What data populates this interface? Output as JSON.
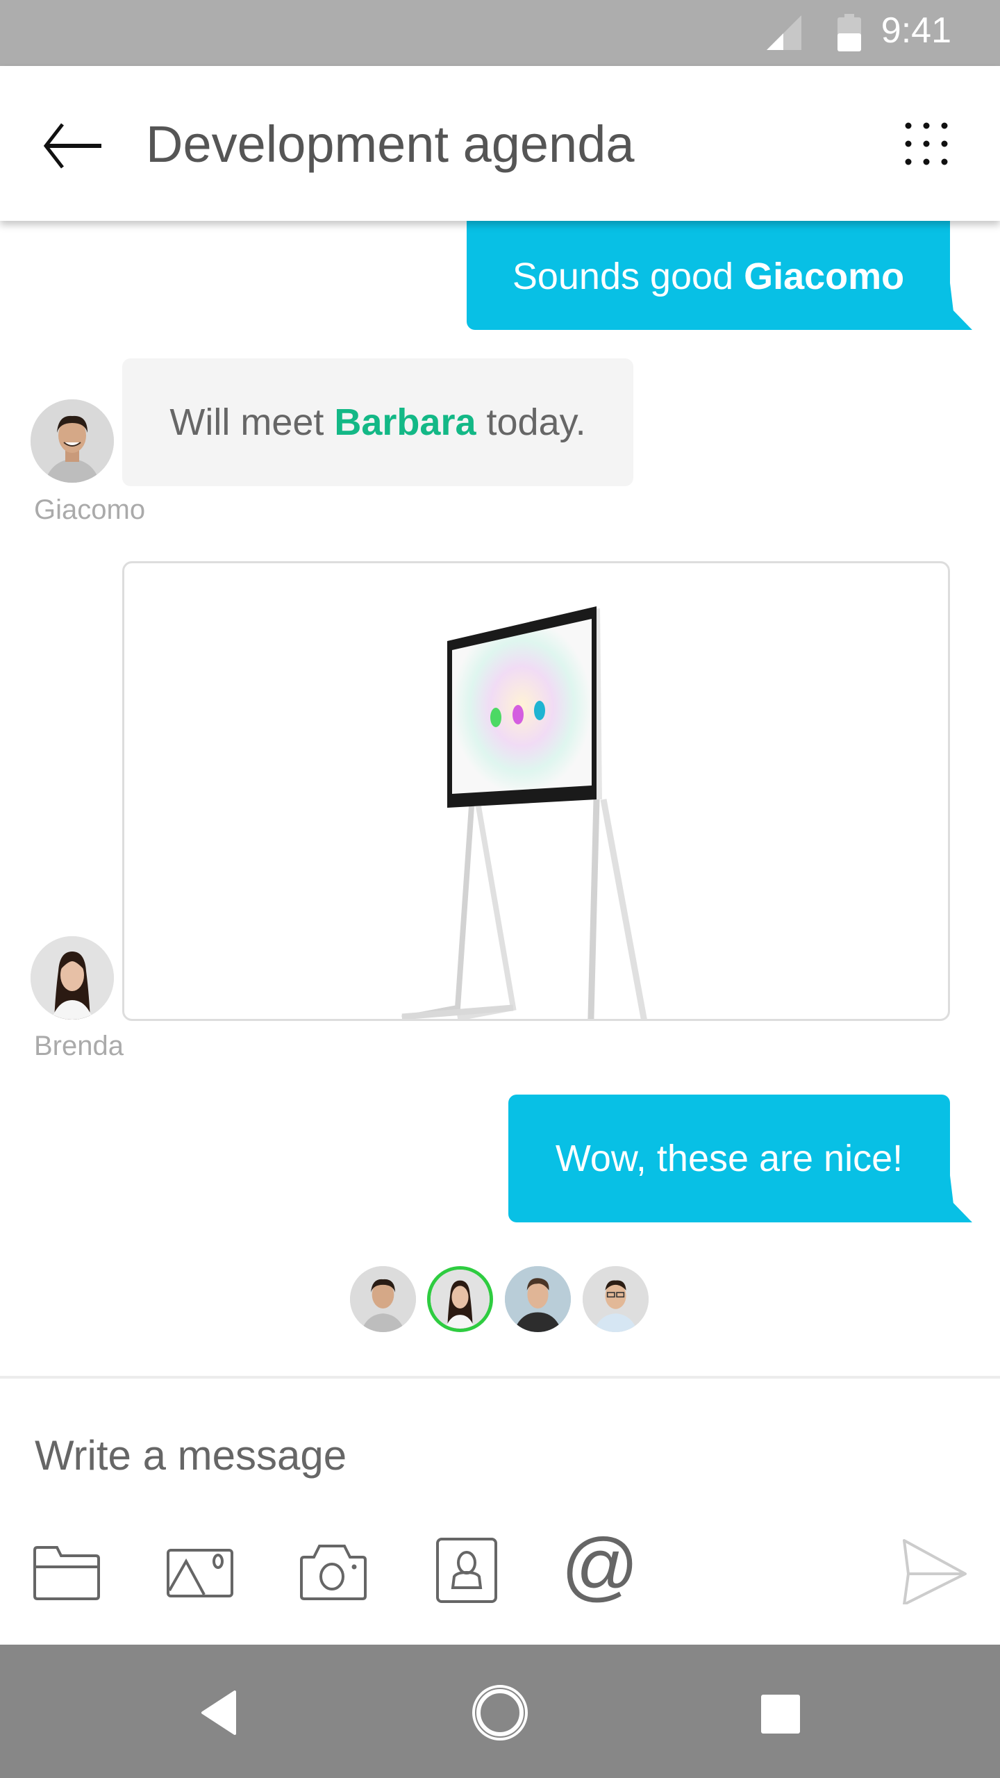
{
  "status_bar": {
    "time": "9:41",
    "signal_icon": "signal-icon",
    "battery_icon": "battery-icon"
  },
  "header": {
    "title": "Development agenda",
    "back_icon": "back-arrow-icon",
    "menu_icon": "grid-menu-icon"
  },
  "messages": [
    {
      "type": "outgoing",
      "text_prefix": "Sounds good ",
      "mention": "Giacomo"
    },
    {
      "type": "incoming",
      "sender": "Giacomo",
      "text_prefix": "Will meet ",
      "mention": "Barbara",
      "text_suffix": " today."
    },
    {
      "type": "incoming-image",
      "sender": "Brenda",
      "image_alt": "Video conferencing display on stand"
    },
    {
      "type": "outgoing",
      "text": "Wow, these are nice!"
    }
  ],
  "seen_by": [
    {
      "name": "Giacomo",
      "active": false
    },
    {
      "name": "Brenda",
      "active": true
    },
    {
      "name": "Participant 3",
      "active": false
    },
    {
      "name": "Participant 4",
      "active": false
    }
  ],
  "composer": {
    "placeholder": "Write a message",
    "value": "",
    "tools": [
      "folder-icon",
      "image-icon",
      "camera-icon",
      "contact-icon",
      "mention-icon"
    ],
    "send_icon": "send-icon"
  },
  "colors": {
    "accent": "#08c0e5",
    "mention": "#13b886",
    "presence": "#2ecc40",
    "status_bar": "#adadad",
    "nav_bar": "#878787"
  }
}
